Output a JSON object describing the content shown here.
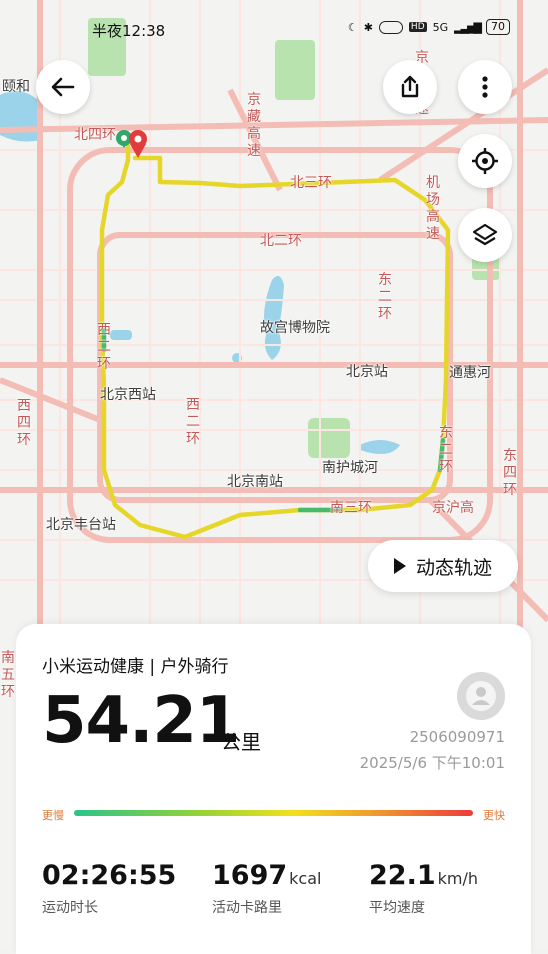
{
  "status_bar": {
    "time": "半夜12:38",
    "network": "5G",
    "battery": "70"
  },
  "map": {
    "labels": {
      "yiheyuan": "颐和",
      "beisihuan": "北四环",
      "jingzang": "京藏高速",
      "jingcheng": "京承高速",
      "beisanhuan": "北三环",
      "jichang": "机场高速",
      "beierhuan": "北二环",
      "dongerhuan": "东二环",
      "gugong": "故宫博物院",
      "beijingzhan": "北京站",
      "tonghuihe": "通惠河",
      "xierhuan": "西二环",
      "beijingxizhan": "北京西站",
      "xisihuan": "西四环",
      "xierhuan2": "西二环",
      "dongsihuan": "东四环",
      "nanhuchenghe": "南护城河",
      "dongerhuan2": "东二环",
      "beijingnanzhan": "北京南站",
      "beijingfengtaizhan": "北京丰台站",
      "nansanhuan": "南三环",
      "jinghu": "京沪高",
      "nanwuhuan": "南五环"
    }
  },
  "buttons": {
    "replay_label": "动态轨迹"
  },
  "icons": {
    "back": "arrow-left-icon",
    "share": "share-icon",
    "more": "more-vertical-icon",
    "locate": "locate-icon",
    "layers": "layers-icon",
    "play": "play-icon",
    "avatar": "avatar-icon"
  },
  "card": {
    "title": "小米运动健康 | 户外骑行",
    "distance": "54.21",
    "distance_unit": "公里",
    "record_id": "2506090971",
    "record_time": "2025/5/6 下午10:01",
    "speed_slow_label": "更慢",
    "speed_fast_label": "更快",
    "stats": [
      {
        "value": "02:26:55",
        "unit": "",
        "label": "运动时长"
      },
      {
        "value": "1697",
        "unit": "kcal",
        "label": "活动卡路里"
      },
      {
        "value": "22.1",
        "unit": "km/h",
        "label": "平均速度"
      }
    ]
  },
  "colors": {
    "route": "#e6d62a",
    "route_green": "#49b96a",
    "road": "#f0b6b0",
    "park": "#a9dca0",
    "water": "#8ccde8",
    "end_marker": "#e23b3b",
    "start_marker": "#2fa86a"
  }
}
